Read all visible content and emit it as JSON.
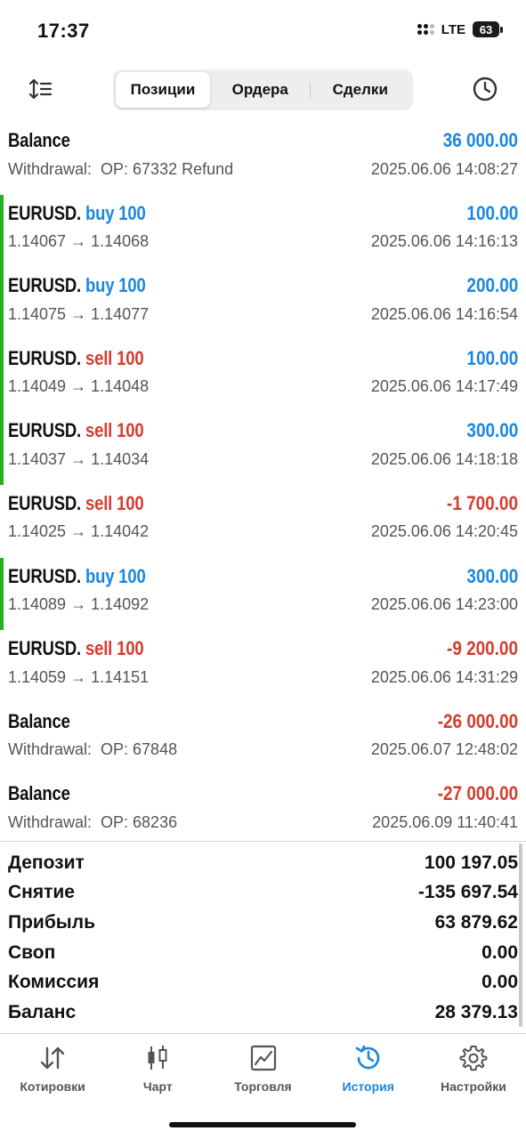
{
  "status_bar": {
    "time": "17:37",
    "network": "LTE",
    "battery": "63"
  },
  "segments": [
    "Позиции",
    "Ордера",
    "Сделки"
  ],
  "segment_active": "Позиции",
  "rows": [
    {
      "symbol": "Balance",
      "side": "",
      "side_color": "",
      "amount": "36 000.00",
      "amount_color": "blue",
      "left": "Withdrawal:  OP: 67332 Refund",
      "time": "2025.06.06 14:08:27",
      "marked": false
    },
    {
      "symbol": "EURUSD.",
      "side": "buy 100",
      "side_color": "blue",
      "amount": "100.00",
      "amount_color": "blue",
      "left": "1.14067 → 1.14068",
      "time": "2025.06.06 14:16:13",
      "marked": true
    },
    {
      "symbol": "EURUSD.",
      "side": "buy 100",
      "side_color": "blue",
      "amount": "200.00",
      "amount_color": "blue",
      "left": "1.14075 → 1.14077",
      "time": "2025.06.06 14:16:54",
      "marked": true
    },
    {
      "symbol": "EURUSD.",
      "side": "sell 100",
      "side_color": "red",
      "amount": "100.00",
      "amount_color": "blue",
      "left": "1.14049 → 1.14048",
      "time": "2025.06.06 14:17:49",
      "marked": true
    },
    {
      "symbol": "EURUSD.",
      "side": "sell 100",
      "side_color": "red",
      "amount": "300.00",
      "amount_color": "blue",
      "left": "1.14037 → 1.14034",
      "time": "2025.06.06 14:18:18",
      "marked": true
    },
    {
      "symbol": "EURUSD.",
      "side": "sell 100",
      "side_color": "red",
      "amount": "-1 700.00",
      "amount_color": "red",
      "left": "1.14025 → 1.14042",
      "time": "2025.06.06 14:20:45",
      "marked": false
    },
    {
      "symbol": "EURUSD.",
      "side": "buy 100",
      "side_color": "blue",
      "amount": "300.00",
      "amount_color": "blue",
      "left": "1.14089 → 1.14092",
      "time": "2025.06.06 14:23:00",
      "marked": true
    },
    {
      "symbol": "EURUSD.",
      "side": "sell 100",
      "side_color": "red",
      "amount": "-9 200.00",
      "amount_color": "red",
      "left": "1.14059 → 1.14151",
      "time": "2025.06.06 14:31:29",
      "marked": false
    },
    {
      "symbol": "Balance",
      "side": "",
      "side_color": "",
      "amount": "-26 000.00",
      "amount_color": "red",
      "left": "Withdrawal:  OP: 67848",
      "time": "2025.06.07 12:48:02",
      "marked": false
    },
    {
      "symbol": "Balance",
      "side": "",
      "side_color": "",
      "amount": "-27 000.00",
      "amount_color": "red",
      "left": "Withdrawal:  OP: 68236",
      "time": "2025.06.09 11:40:41",
      "marked": false
    }
  ],
  "summary": [
    {
      "label": "Депозит",
      "value": "100 197.05"
    },
    {
      "label": "Снятие",
      "value": "-135 697.54"
    },
    {
      "label": "Прибыль",
      "value": "63 879.62"
    },
    {
      "label": "Своп",
      "value": "0.00"
    },
    {
      "label": "Комиссия",
      "value": "0.00"
    },
    {
      "label": "Баланс",
      "value": "28 379.13"
    }
  ],
  "tabs": [
    {
      "label": "Котировки",
      "icon": "quotes-icon",
      "active": false
    },
    {
      "label": "Чарт",
      "icon": "candlestick-chart-icon",
      "active": false
    },
    {
      "label": "Торговля",
      "icon": "trade-chart-icon",
      "active": false
    },
    {
      "label": "История",
      "icon": "history-icon",
      "active": true
    },
    {
      "label": "Настройки",
      "icon": "gear-icon",
      "active": false
    }
  ],
  "colors": {
    "blue": "#1a86e0",
    "red": "#d53b2d",
    "green_marker": "#22b21f",
    "active_tab": "#1a86e0"
  }
}
